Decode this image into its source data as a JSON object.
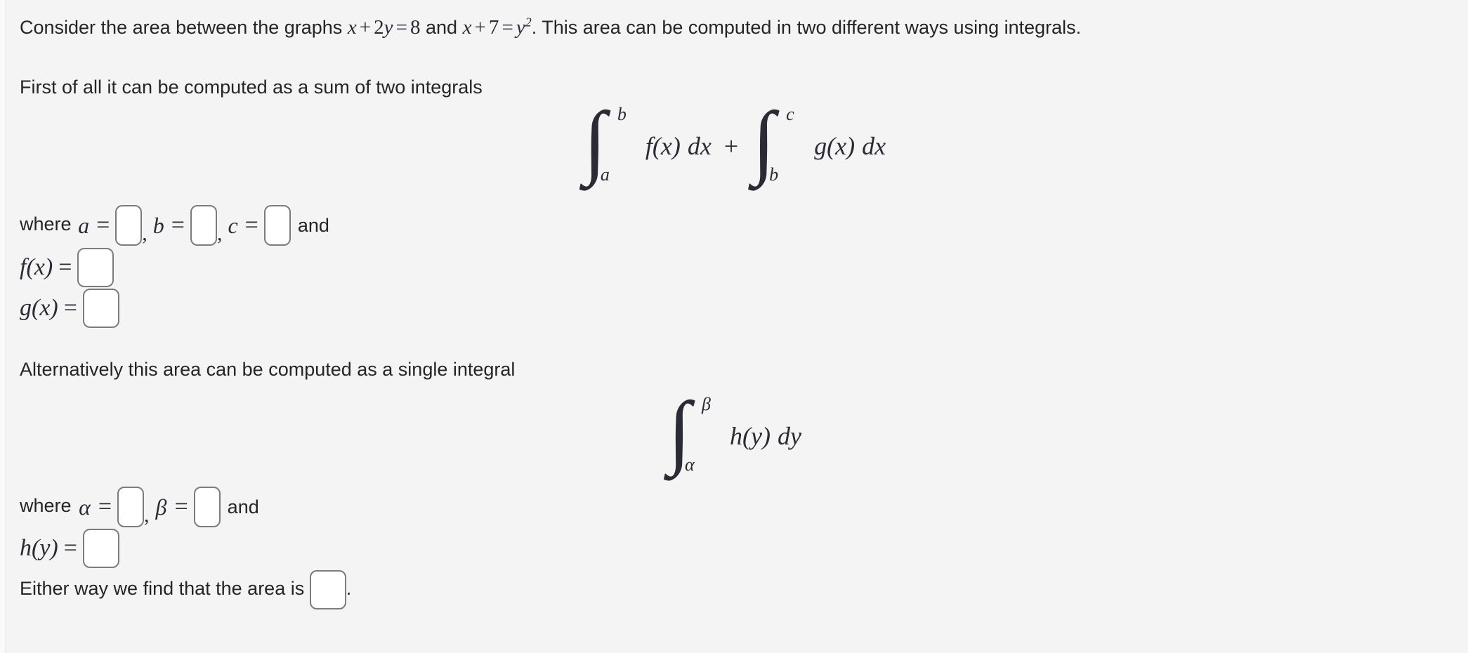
{
  "page": {
    "background_color": "#f4f4f4",
    "text_color": "#252525",
    "math_color": "#2b2b35",
    "box_border_color": "#7c7c7c",
    "box_fill_color": "#ffffff"
  },
  "intro": {
    "part1": "Consider the area between the graphs",
    "equation1": {
      "lhs_var1": "x",
      "op1": "+",
      "coef": "2",
      "var2": "y",
      "eq": "=",
      "rhs": "8"
    },
    "conjunction": "and",
    "equation2": {
      "lhs_var1": "x",
      "op1": "+",
      "num": "7",
      "eq": "=",
      "rhs_var": "y",
      "rhs_exp": "2"
    },
    "part2": ". This area can be computed in two different ways using integrals."
  },
  "first_method": {
    "lead_text": "First of all it can be computed as a sum of two integrals",
    "equation": {
      "integral1": {
        "lower": "a",
        "upper": "b",
        "integrand": "f(x)",
        "differential": "dx"
      },
      "operator": "+",
      "integral2": {
        "lower": "b",
        "upper": "c",
        "integrand": "g(x)",
        "differential": "dx"
      }
    },
    "where_row": {
      "where_label": "where",
      "a_symbol": "a",
      "a_eq": "=",
      "comma1": ",",
      "b_symbol": "b",
      "b_eq": "=",
      "comma2": ",",
      "c_symbol": "c",
      "c_eq": "=",
      "and_label": "and"
    },
    "f_row": {
      "symbol": "f(x)",
      "eq": "="
    },
    "g_row": {
      "symbol": "g(x)",
      "eq": "="
    },
    "inputs": {
      "a": {
        "value": "",
        "placeholder": ""
      },
      "b": {
        "value": "",
        "placeholder": ""
      },
      "c": {
        "value": "",
        "placeholder": ""
      },
      "f": {
        "value": "",
        "placeholder": ""
      },
      "g": {
        "value": "",
        "placeholder": ""
      }
    }
  },
  "second_method": {
    "lead_text": "Alternatively this area can be computed as a single integral",
    "equation": {
      "integral": {
        "lower": "α",
        "upper": "β",
        "integrand": "h(y)",
        "differential": "dy"
      }
    },
    "where_row": {
      "where_label": "where",
      "alpha_symbol": "α",
      "alpha_eq": "=",
      "comma1": ",",
      "beta_symbol": "β",
      "beta_eq": "=",
      "and_label": "and"
    },
    "h_row": {
      "symbol": "h(y)",
      "eq": "="
    },
    "inputs": {
      "alpha": {
        "value": "",
        "placeholder": ""
      },
      "beta": {
        "value": "",
        "placeholder": ""
      },
      "h": {
        "value": "",
        "placeholder": ""
      }
    }
  },
  "conclusion": {
    "text": "Either way we find that the area is",
    "period": ".",
    "input": {
      "value": "",
      "placeholder": ""
    }
  }
}
